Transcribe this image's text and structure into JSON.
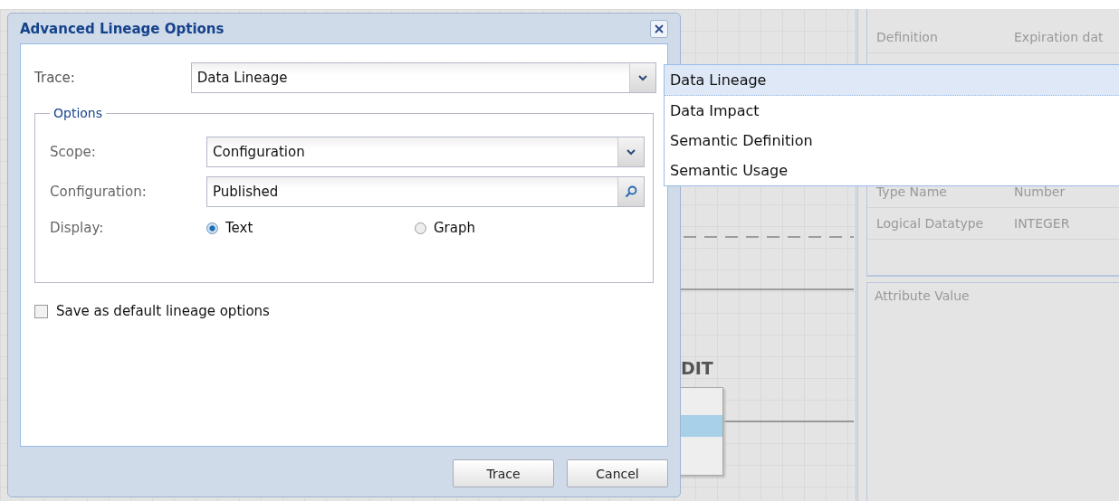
{
  "background": {
    "entity_title": "DIT",
    "properties": [
      {
        "name": "Definition",
        "value": "Expiration dat"
      },
      {
        "name": "Type Name",
        "value": "Number"
      },
      {
        "name": "Logical Datatype",
        "value": "INTEGER"
      }
    ],
    "attribute_header": "Attribute Value"
  },
  "dialog": {
    "title": "Advanced Lineage Options",
    "trace": {
      "label": "Trace:",
      "value": "Data Lineage"
    },
    "options": {
      "legend": "Options",
      "scope": {
        "label": "Scope:",
        "value": "Configuration"
      },
      "configuration": {
        "label": "Configuration:",
        "value": "Published"
      },
      "display": {
        "label": "Display:",
        "choices": [
          {
            "label": "Text",
            "selected": true
          },
          {
            "label": "Graph",
            "selected": false
          }
        ]
      }
    },
    "save_default": {
      "label": "Save as default lineage options",
      "checked": false
    },
    "buttons": [
      "Trace",
      "Cancel"
    ]
  },
  "dropdown": [
    {
      "label": "Data Lineage",
      "selected": true
    },
    {
      "label": "Data Impact",
      "selected": false
    },
    {
      "label": "Semantic Definition",
      "selected": false
    },
    {
      "label": "Semantic Usage",
      "selected": false
    }
  ]
}
